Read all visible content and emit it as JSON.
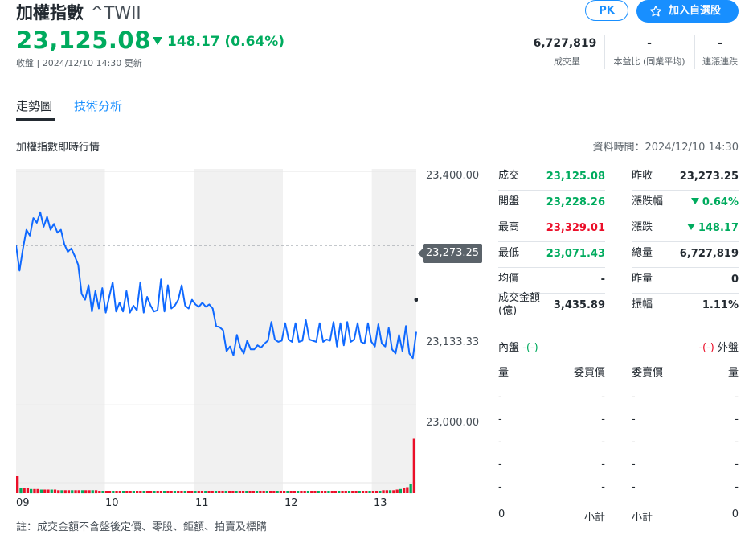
{
  "header": {
    "name": "加權指數",
    "symbol": "^TWII",
    "price": "23,125.08",
    "change": "148.17 (0.64%)",
    "status": "收盤 | 2024/12/10 14:30 更新",
    "pk_label": "PK",
    "add_label": "加入自選股",
    "stats": [
      {
        "value": "6,727,819",
        "label": "成交量"
      },
      {
        "value": "-",
        "label": "本益比 (同業平均)"
      },
      {
        "value": "-",
        "label": "連漲連跌"
      }
    ]
  },
  "tabs": [
    {
      "label": "走勢圖",
      "active": true
    },
    {
      "label": "技術分析",
      "active": false
    }
  ],
  "section": {
    "title": "加權指數即時行情",
    "data_time": "資料時間：2024/12/10 14:30"
  },
  "colors": {
    "up": "#eb0f29",
    "down": "#00ab5e",
    "accent": "#188fff",
    "line": "#0f69ff"
  },
  "chart_data": {
    "type": "line",
    "y_ticks": [
      "23,400.00",
      "23,133.33",
      "23,000.00"
    ],
    "ylim": [
      22866.67,
      23400
    ],
    "prev_close_label": "23,273.25",
    "prev_close": 23273.25,
    "x_ticks": [
      "09",
      "10",
      "11",
      "12",
      "13"
    ],
    "series": [
      {
        "values": [
          23273,
          23230,
          23268,
          23300,
          23290,
          23320,
          23312,
          23330,
          23305,
          23322,
          23300,
          23310,
          23295,
          23300,
          23275,
          23262,
          23268,
          23255,
          23240,
          23190,
          23180,
          23205,
          23160,
          23195,
          23165,
          23200,
          23158,
          23185,
          23210,
          23160,
          23175,
          23160,
          23195,
          23158,
          23170,
          23162,
          23210,
          23158,
          23185,
          23170,
          23160,
          23162,
          23215,
          23160,
          23205,
          23165,
          23170,
          23180,
          23205,
          23170,
          23165,
          23180,
          23172,
          23168,
          23175,
          23168,
          23172,
          23165,
          23135,
          23133,
          23128,
          23092,
          23100,
          23085,
          23120,
          23098,
          23088,
          23110,
          23095,
          23095,
          23102,
          23098,
          23105,
          23110,
          23142,
          23112,
          23108,
          23110,
          23140,
          23112,
          23108,
          23140,
          23108,
          23110,
          23145,
          23112,
          23110,
          23108,
          23140,
          23108,
          23112,
          23110,
          23142,
          23100,
          23140,
          23102,
          23142,
          23108,
          23112,
          23140,
          23108,
          23105,
          23140,
          23108,
          23100,
          23138,
          23105,
          23100,
          23132,
          23095,
          23088,
          23120,
          23092,
          23135,
          23088,
          23080,
          23125
        ]
      }
    ],
    "volume": [
      0.28,
      0.09,
      0.08,
      0.08,
      0.07,
      0.07,
      0.07,
      0.06,
      0.06,
      0.06,
      0.06,
      0.06,
      0.05,
      0.05,
      0.05,
      0.05,
      0.05,
      0.05,
      0.05,
      0.05,
      0.05,
      0.05,
      0.05,
      0.05,
      0.04,
      0.04,
      0.04,
      0.04,
      0.04,
      0.04,
      0.04,
      0.04,
      0.04,
      0.04,
      0.04,
      0.04,
      0.04,
      0.04,
      0.04,
      0.04,
      0.04,
      0.04,
      0.04,
      0.04,
      0.04,
      0.04,
      0.04,
      0.04,
      0.04,
      0.04,
      0.04,
      0.04,
      0.04,
      0.04,
      0.04,
      0.04,
      0.04,
      0.04,
      0.04,
      0.04,
      0.04,
      0.04,
      0.04,
      0.04,
      0.04,
      0.04,
      0.04,
      0.04,
      0.04,
      0.04,
      0.04,
      0.04,
      0.04,
      0.04,
      0.04,
      0.04,
      0.04,
      0.04,
      0.04,
      0.04,
      0.04,
      0.04,
      0.04,
      0.04,
      0.04,
      0.04,
      0.04,
      0.04,
      0.04,
      0.04,
      0.04,
      0.04,
      0.04,
      0.04,
      0.04,
      0.04,
      0.04,
      0.04,
      0.04,
      0.04,
      0.04,
      0.04,
      0.04,
      0.04,
      0.04,
      0.04,
      0.04,
      0.05,
      0.05,
      0.05,
      0.05,
      0.06,
      0.07,
      0.08,
      0.1,
      0.15,
      0.9
    ]
  },
  "quote": {
    "left": [
      {
        "label": "成交",
        "value": "23,125.08",
        "color": "g"
      },
      {
        "label": "開盤",
        "value": "23,228.26",
        "color": "g"
      },
      {
        "label": "最高",
        "value": "23,329.01",
        "color": "r"
      },
      {
        "label": "最低",
        "value": "23,071.43",
        "color": "g"
      },
      {
        "label": "均價",
        "value": "-",
        "color": "k"
      },
      {
        "label": "成交金額\n(億)",
        "value": "3,435.89",
        "color": "k"
      }
    ],
    "right": [
      {
        "label": "昨收",
        "value": "23,273.25",
        "color": "k"
      },
      {
        "label": "漲跌幅",
        "value": "0.64%",
        "color": "g",
        "arrow": true
      },
      {
        "label": "漲跌",
        "value": "148.17",
        "color": "g",
        "arrow": true
      },
      {
        "label": "總量",
        "value": "6,727,819",
        "color": "k"
      },
      {
        "label": "昨量",
        "value": "0",
        "color": "k"
      },
      {
        "label": "振幅",
        "value": "1.11%",
        "color": "k"
      }
    ]
  },
  "orderbook": {
    "inner_label": "內盤",
    "inner_value": "-(-)",
    "outer_label": "外盤",
    "outer_value": "-(-)",
    "headers": [
      "量",
      "委買價",
      "委賣價",
      "量"
    ],
    "rows": [
      [
        "-",
        "-",
        "-",
        "-"
      ],
      [
        "-",
        "-",
        "-",
        "-"
      ],
      [
        "-",
        "-",
        "-",
        "-"
      ],
      [
        "-",
        "-",
        "-",
        "-"
      ],
      [
        "-",
        "-",
        "-",
        "-"
      ]
    ],
    "footer": [
      "0",
      "小計",
      "小計",
      "0"
    ]
  },
  "note": "註：成交金額不含盤後定價、零股、鉅額、拍賣及標購"
}
